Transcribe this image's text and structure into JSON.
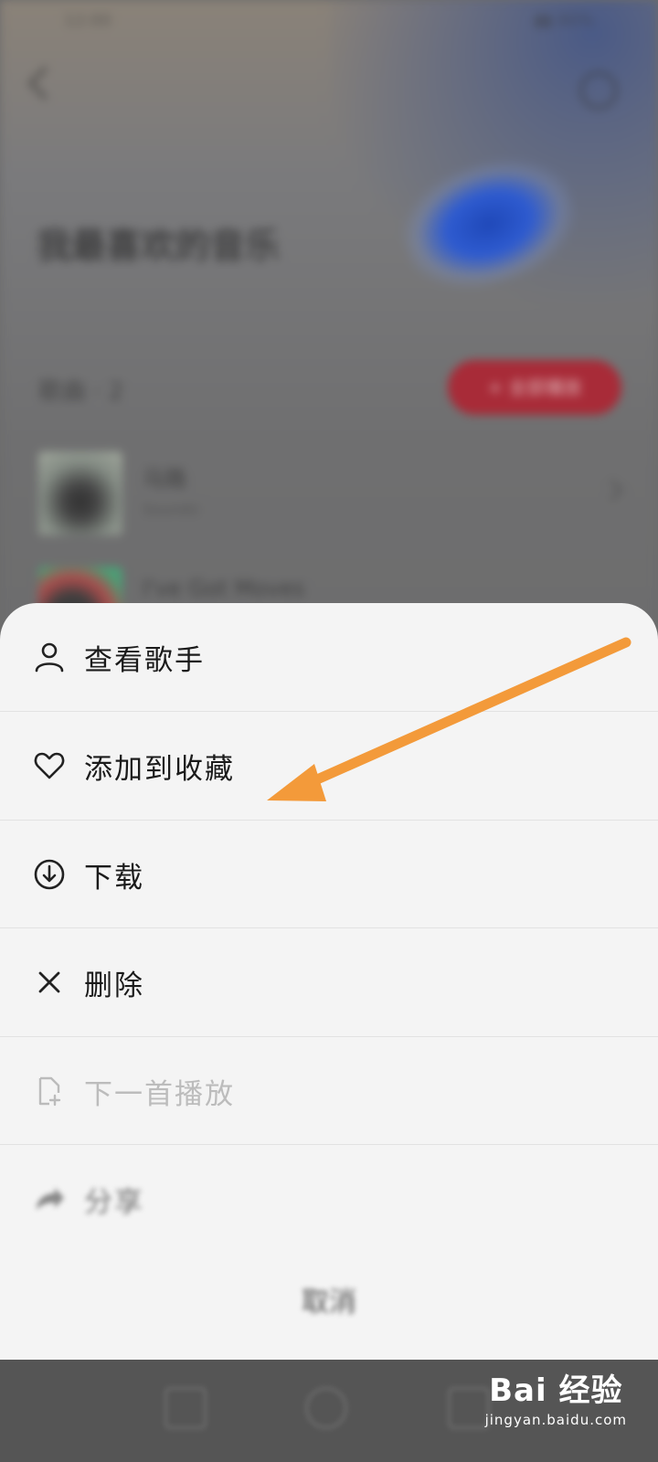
{
  "background": {
    "playlist_title": "我最喜欢的音乐",
    "count_label": "歌曲 · 2",
    "play_all_label": "+ 全部播放",
    "songs": [
      {
        "title": "马路",
        "subtitle": "SoundU"
      },
      {
        "title": "I've Got Moves",
        "subtitle": ""
      }
    ]
  },
  "sheet": {
    "items": [
      {
        "label": "查看歌手",
        "icon": "user-icon"
      },
      {
        "label": "添加到收藏",
        "icon": "heart-icon"
      },
      {
        "label": "下载",
        "icon": "download-icon"
      },
      {
        "label": "删除",
        "icon": "close-icon"
      },
      {
        "label": "下一首播放",
        "icon": "play-next-icon"
      },
      {
        "label": "分享",
        "icon": "share-icon"
      }
    ],
    "cancel_label": "取消"
  },
  "annotation": {
    "color": "#f39a3a"
  },
  "watermark": {
    "main": "Bai 经验",
    "sub": "jingyan.baidu.com"
  }
}
